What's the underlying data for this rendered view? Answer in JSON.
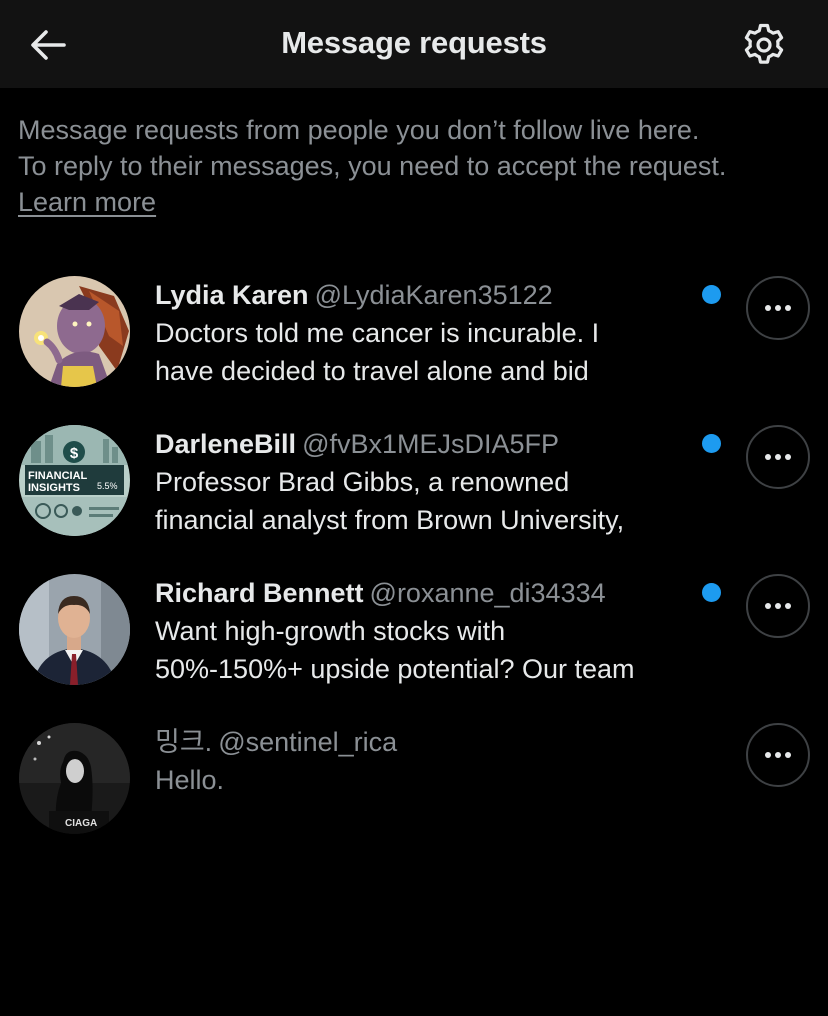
{
  "header": {
    "title": "Message requests"
  },
  "intro": {
    "line1": "Message requests from people you don’t follow live here.",
    "line2": "To reply to their messages, you need to accept the request.",
    "learn_more": "Learn more"
  },
  "requests": [
    {
      "name": "Lydia Karen",
      "handle": "@LydiaKaren35122",
      "preview_line1": "Doctors told me cancer is incurable. I",
      "preview_line2": "have decided to travel alone and bid",
      "unread": true
    },
    {
      "name": "DarleneBill",
      "handle": "@fvBx1MEJsDIA5FP",
      "preview_line1": "Professor Brad Gibbs, a renowned",
      "preview_line2": "financial analyst from Brown University,",
      "unread": true,
      "avatar_text": {
        "line1": "FINANCIAL",
        "line2": "INSIGHTS",
        "figure": "5.5%",
        "dollar": "$"
      }
    },
    {
      "name": "Richard Bennett",
      "handle": "@roxanne_di34334",
      "preview_line1": "Want high-growth stocks with",
      "preview_line2": "50%-150%+ upside potential? Our team",
      "unread": true
    },
    {
      "name": "밍크.",
      "handle": "@sentinel_rica",
      "preview_line1": "Hello.",
      "unread": false,
      "avatar_text": {
        "shirt": "CIAGA"
      }
    }
  ],
  "colors": {
    "background": "#000000",
    "header_bg": "#121212",
    "text_primary": "#e7e9ea",
    "text_secondary": "#8b9095",
    "unread_dot": "#1d9bf0"
  }
}
